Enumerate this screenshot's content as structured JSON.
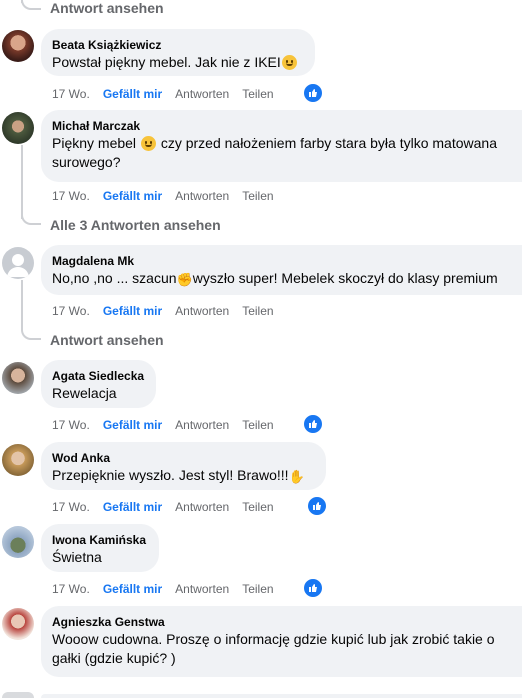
{
  "view_replies_top": "Antwort ansehen",
  "comments": [
    {
      "author": "Beata Książkiewicz",
      "text": "Powstał piękny mebel. Jak nie z IKEI",
      "emoji": "smile",
      "time": "17 Wo.",
      "like": "Gefällt mir",
      "reply": "Antworten",
      "share": "Teilen",
      "reaction": "like"
    },
    {
      "author": "Michał Marczak",
      "text_a": "Piękny mebel ",
      "text_b": " czy przed nałożeniem farby stara była tylko matowana",
      "text_line2": "surowego?",
      "emoji": "smile",
      "time": "17 Wo.",
      "like": "Gefällt mir",
      "reply": "Antworten",
      "share": "Teilen"
    },
    {
      "author": "Magdalena Mk",
      "text_a": "No,no ,no ... szacun",
      "text_b": "wyszło super! Mebelek skoczył do klasy premium",
      "emoji": "flexed-biceps",
      "time": "17 Wo.",
      "like": "Gefällt mir",
      "reply": "Antworten",
      "share": "Teilen"
    },
    {
      "author": "Agata Siedlecka",
      "text": "Rewelacja",
      "time": "17 Wo.",
      "like": "Gefällt mir",
      "reply": "Antworten",
      "share": "Teilen",
      "reaction": "like"
    },
    {
      "author": "Wod Anka",
      "text": "Przepięknie wyszło. Jest styl! Brawo!!!",
      "emoji": "clapping-hands",
      "time": "17 Wo.",
      "like": "Gefällt mir",
      "reply": "Antworten",
      "share": "Teilen",
      "reaction": "like"
    },
    {
      "author": "Iwona Kamińska",
      "text": "Świetna",
      "time": "17 Wo.",
      "like": "Gefällt mir",
      "reply": "Antworten",
      "share": "Teilen",
      "reaction": "like"
    },
    {
      "author": "Agnieszka Genstwa",
      "text": "Wooow cudowna. Proszę o informację gdzie kupić lub jak zrobić takie o",
      "text_line2": "gałki (gdzie kupić? )"
    }
  ],
  "view_replies_3": "Alle 3 Antworten ansehen",
  "view_reply_magdalena": "Antwort ansehen",
  "colors": {
    "link_blue": "#1877f2",
    "bubble": "#f0f2f5",
    "meta_gray": "#65676b"
  }
}
